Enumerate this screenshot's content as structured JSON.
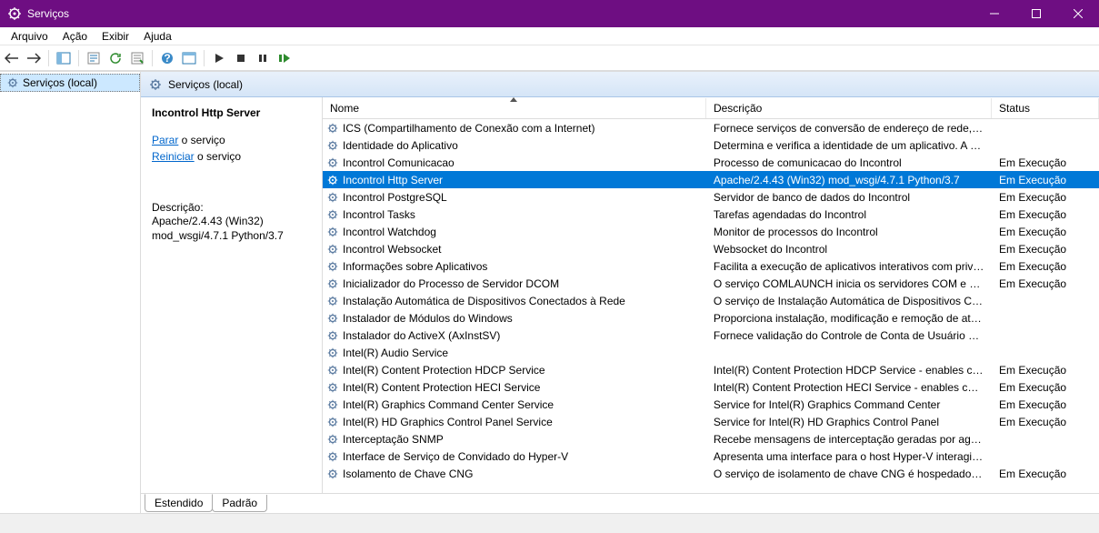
{
  "window": {
    "title": "Serviços"
  },
  "menu": {
    "items": [
      "Arquivo",
      "Ação",
      "Exibir",
      "Ajuda"
    ]
  },
  "tree": {
    "root": "Serviços (local)"
  },
  "content_header": "Serviços (local)",
  "detail": {
    "selected_name": "Incontrol Http Server",
    "stop_link": "Parar",
    "stop_suffix": " o serviço",
    "restart_link": "Reiniciar",
    "restart_suffix": " o serviço",
    "desc_label": "Descrição:",
    "desc_text": "Apache/2.4.43 (Win32) mod_wsgi/4.7.1 Python/3.7"
  },
  "columns": {
    "name": "Nome",
    "desc": "Descrição",
    "status": "Status"
  },
  "services": [
    {
      "name": "ICS (Compartilhamento de Conexão com a Internet)",
      "desc": "Fornece serviços de conversão de endereço de rede, end...",
      "status": ""
    },
    {
      "name": "Identidade do Aplicativo",
      "desc": "Determina e verifica a identidade de um aplicativo. A de...",
      "status": ""
    },
    {
      "name": "Incontrol Comunicacao",
      "desc": "Processo de comunicacao do Incontrol",
      "status": "Em Execução"
    },
    {
      "name": "Incontrol Http Server",
      "desc": "Apache/2.4.43 (Win32) mod_wsgi/4.7.1 Python/3.7",
      "status": "Em Execução",
      "selected": true
    },
    {
      "name": "Incontrol PostgreSQL",
      "desc": "Servidor de banco de dados do Incontrol",
      "status": "Em Execução"
    },
    {
      "name": "Incontrol Tasks",
      "desc": "Tarefas agendadas do Incontrol",
      "status": "Em Execução"
    },
    {
      "name": "Incontrol Watchdog",
      "desc": "Monitor de processos do Incontrol",
      "status": "Em Execução"
    },
    {
      "name": "Incontrol Websocket",
      "desc": "Websocket do Incontrol",
      "status": "Em Execução"
    },
    {
      "name": "Informações sobre Aplicativos",
      "desc": "Facilita a execução de aplicativos interativos com privilé...",
      "status": "Em Execução"
    },
    {
      "name": "Inicializador do Processo de Servidor DCOM",
      "desc": "O serviço COMLAUNCH inicia os servidores COM e DCO...",
      "status": "Em Execução"
    },
    {
      "name": "Instalação Automática de Dispositivos Conectados à Rede",
      "desc": "O serviço de Instalação Automática de Dispositivos Con...",
      "status": ""
    },
    {
      "name": "Instalador de Módulos do Windows",
      "desc": "Proporciona instalação, modificação e remoção de atual...",
      "status": ""
    },
    {
      "name": "Instalador do ActiveX (AxInstSV)",
      "desc": "Fornece validação do Controle de Conta de Usuário para...",
      "status": ""
    },
    {
      "name": "Intel(R) Audio Service",
      "desc": "",
      "status": ""
    },
    {
      "name": "Intel(R) Content Protection HDCP Service",
      "desc": "Intel(R) Content Protection HDCP Service - enables com...",
      "status": "Em Execução"
    },
    {
      "name": "Intel(R) Content Protection HECI Service",
      "desc": "Intel(R) Content Protection HECI Service - enables com...",
      "status": "Em Execução"
    },
    {
      "name": "Intel(R) Graphics Command Center Service",
      "desc": "Service for Intel(R) Graphics Command Center",
      "status": "Em Execução"
    },
    {
      "name": "Intel(R) HD Graphics Control Panel Service",
      "desc": "Service for Intel(R) HD Graphics Control Panel",
      "status": "Em Execução"
    },
    {
      "name": "Interceptação SNMP",
      "desc": "Recebe mensagens de interceptação geradas por agente...",
      "status": ""
    },
    {
      "name": "Interface de Serviço de Convidado do Hyper-V",
      "desc": "Apresenta uma interface para o host Hyper-V interagir c...",
      "status": ""
    },
    {
      "name": "Isolamento de Chave CNG",
      "desc": "O serviço de isolamento de chave CNG é hospedado pel...",
      "status": "Em Execução"
    }
  ],
  "tabs": {
    "extended": "Estendido",
    "standard": "Padrão"
  }
}
